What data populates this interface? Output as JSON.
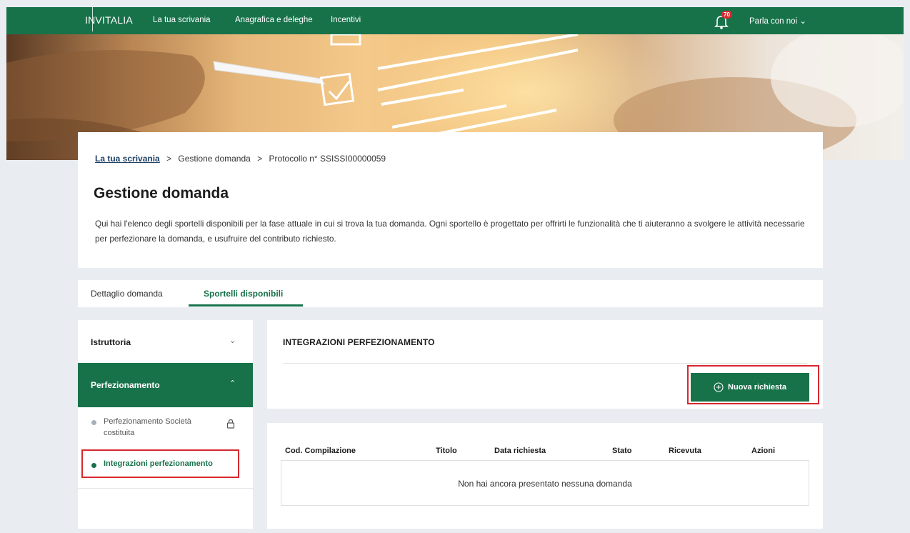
{
  "topbar": {
    "brand": "INVITALIA",
    "nav": [
      "La tua scrivania",
      "Anagrafica e deleghe",
      "Incentivi"
    ],
    "notifications_count": "70",
    "chat_label": "Parla con noi",
    "chat_chevron": "⌄"
  },
  "breadcrumb": {
    "home": "La tua scrivania",
    "separator": ">",
    "current": "Gestione domanda",
    "protocol": "Protocollo n° SSISSI00000059"
  },
  "page": {
    "title": "Gestione domanda",
    "description": "Qui hai l'elenco degli sportelli disponibili per la fase attuale in cui si trova la tua domanda. Ogni sportello è progettato per offrirti le funzionalità che ti aiuteranno a svolgere le attività necessarie per perfezionare la domanda, e usufruire del contributo richiesto."
  },
  "tabs": [
    {
      "label": "Dettaglio domanda",
      "active": false
    },
    {
      "label": "Sportelli disponibili",
      "active": true
    }
  ],
  "sidebar": {
    "istruttoria": {
      "label": "Istruttoria",
      "chevron": "⌄"
    },
    "perfezionamento": {
      "label": "Perfezionamento",
      "chevron": "⌃"
    },
    "sub_items": [
      {
        "label": "Perfezionamento Società costituita",
        "locked": true
      },
      {
        "label": "Integrazioni perfezionamento",
        "active": true
      }
    ]
  },
  "main": {
    "section_title": "INTEGRAZIONI PERFEZIONAMENTO",
    "new_request_label": "Nuova richiesta"
  },
  "table": {
    "columns": [
      "Cod. Compilazione",
      "Titolo",
      "Data richiesta",
      "Stato",
      "Ricevuta",
      "Azioni"
    ],
    "empty_message": "Non hai ancora presentato nessuna domanda"
  },
  "colors": {
    "brand_green": "#17724a",
    "highlight_red": "#d7282f",
    "page_bg": "#e9edf2"
  }
}
